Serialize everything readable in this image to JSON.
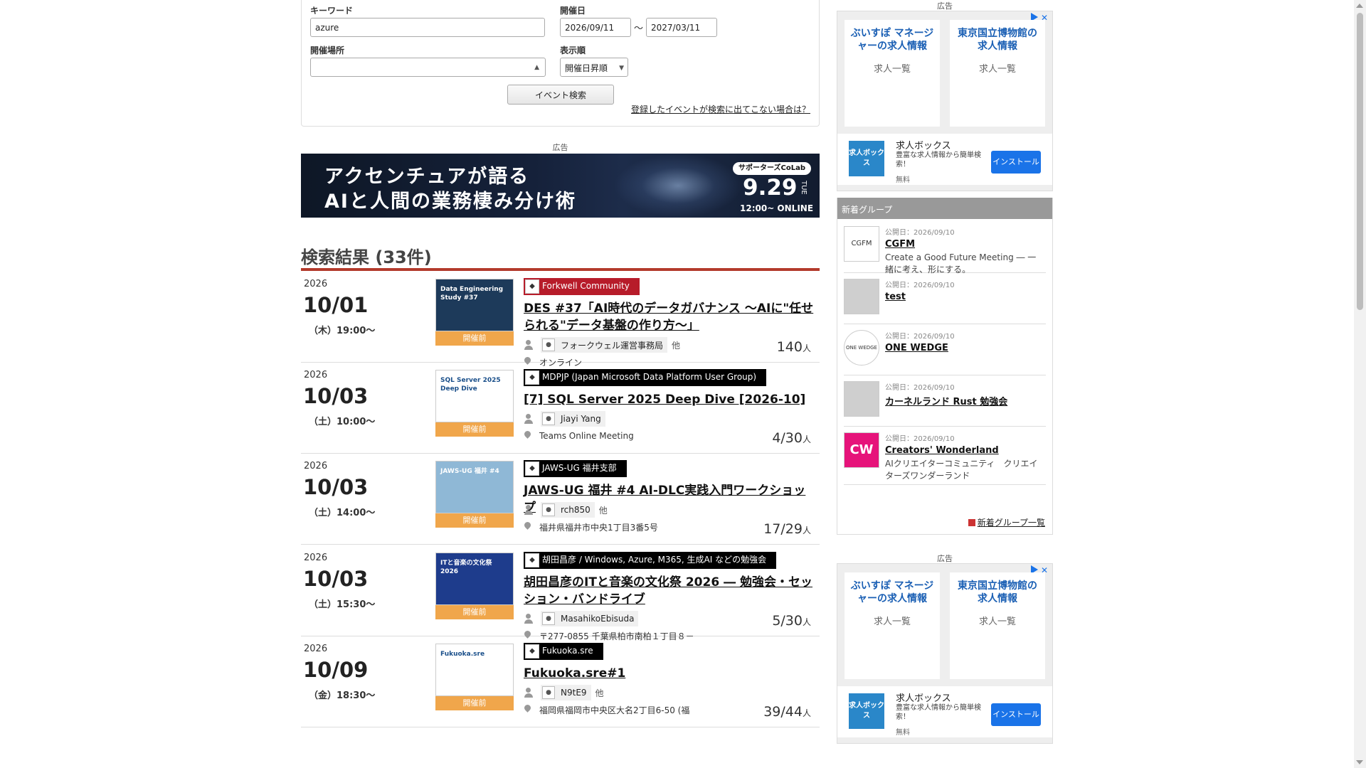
{
  "search": {
    "keyword_label": "キーワード",
    "keyword_value": "azure",
    "date_label": "開催日",
    "date_from": "2026/09/11",
    "date_sep": "〜",
    "date_to": "2027/03/11",
    "place_label": "開催場所",
    "place_value": "",
    "order_label": "表示順",
    "order_value": "開催日昇順",
    "search_button": "イベント検索",
    "help_link": "登録したイベントが検索に出てこない場合は？"
  },
  "banner": {
    "ad_label": "広告",
    "line1": "アクセンチュアが語る",
    "line2": "AIと人間の業務棲み分け術",
    "badge": "サポーターズCoLab",
    "date": "9.29",
    "dow": "TUE",
    "time": "12:00~ ONLINE"
  },
  "results": {
    "title": "検索結果 (33件)",
    "events": [
      {
        "year": "2026",
        "date": "10/01",
        "time": "（木）19:00～",
        "status": "開催前",
        "group": "Forkwell Community",
        "group_color": "#b71c2a",
        "title": "DES #37「AI時代のデータガバナンス ～AIに\"任せられる\"データ基盤の作り方～」",
        "owner": "フォークウェル運営事務局",
        "owner_etc": "他",
        "place": "オンライン",
        "count": "140",
        "unit": "人",
        "thumb_text": "Data Engineering Study #37",
        "thumb_bg": "#1d3a5a"
      },
      {
        "year": "2026",
        "date": "10/03",
        "time": "（土）10:00～",
        "status": "開催前",
        "group": "MDPJP (Japan Microsoft Data Platform User Group)",
        "group_color": "#000000",
        "title": "[7] SQL Server 2025 Deep Dive [2026-10]",
        "owner": "Jiayi Yang",
        "owner_etc": "",
        "place": "Teams Online Meeting",
        "count": "4/30",
        "unit": "人",
        "thumb_text": "SQL Server 2025 Deep Dive",
        "thumb_bg": "#ffffff"
      },
      {
        "year": "2026",
        "date": "10/03",
        "time": "（土）14:00～",
        "status": "開催前",
        "group": "JAWS-UG 福井支部",
        "group_color": "#000000",
        "title": "JAWS-UG 福井 #4 AI-DLC実践入門ワークショップ",
        "owner": "rch850",
        "owner_etc": "他",
        "place": "福井県福井市中央1丁目3番5号",
        "count": "17/29",
        "unit": "人",
        "thumb_text": "JAWS-UG 福井 #4",
        "thumb_bg": "#8fb8d6"
      },
      {
        "year": "2026",
        "date": "10/03",
        "time": "（土）15:30～",
        "status": "開催前",
        "group": "胡田昌彦 / Windows, Azure, M365, 生成AI などの勉強会",
        "group_color": "#000000",
        "title": "胡田昌彦のITと音楽の文化祭 2026 ― 勉強会・セッション・バンドライブ",
        "owner": "MasahikoEbisuda",
        "owner_etc": "",
        "place": "〒277-0855 千葉県柏市南柏１丁目８－",
        "count": "5/30",
        "unit": "人",
        "thumb_text": "ITと音楽の文化祭 2026",
        "thumb_bg": "#1e3c8c"
      },
      {
        "year": "2026",
        "date": "10/09",
        "time": "（金）18:30～",
        "status": "開催前",
        "group": "Fukuoka.sre",
        "group_color": "#000000",
        "title": "Fukuoka.sre#1",
        "owner": "N9tE9",
        "owner_etc": "他",
        "place": "福岡県福岡市中央区大名2丁目6-50 (福",
        "count": "39/44",
        "unit": "人",
        "thumb_text": "Fukuoka.sre",
        "thumb_bg": "#ffffff"
      }
    ]
  },
  "sidebar": {
    "ad_label": "広告",
    "ad_cards": [
      {
        "title": "ぶいすぽ マネージャーの求人情報",
        "sub": "求人一覧"
      },
      {
        "title": "東京国立博物館の求人情報",
        "sub": "求人一覧"
      }
    ],
    "app": {
      "icon": "求人ボックス",
      "name": "求人ボックス",
      "desc": "豊富な求人情報から簡単検索！",
      "price": "無料",
      "install": "インストール"
    },
    "groups_header": "新着グループ",
    "groups": [
      {
        "date": "公開日：2026/09/10",
        "name": "CGFM",
        "desc": "Create a Good Future Meeting ― 一緒に考え、形にする。",
        "logo": "CGFM"
      },
      {
        "date": "公開日：2026/09/10",
        "name": "test",
        "desc": "",
        "logo": ""
      },
      {
        "date": "公開日：2026/09/10",
        "name": "ONE WEDGE",
        "desc": "",
        "logo": "ONE WEDGE"
      },
      {
        "date": "公開日：2026/09/10",
        "name": "カーネルランド Rust 勉強会",
        "desc": "",
        "logo": ""
      },
      {
        "date": "公開日：2026/09/10",
        "name": "Creators' Wonderland",
        "desc": "AIクリエイターコミュニティ　クリエイターズワンダーランド",
        "logo": "CW"
      }
    ],
    "groups_more": "新着グループ一覧"
  },
  "colors": {
    "accent_rule": "#b33a2c",
    "status_badge": "#f0a64b",
    "ad_blue": "#1a73e8"
  }
}
